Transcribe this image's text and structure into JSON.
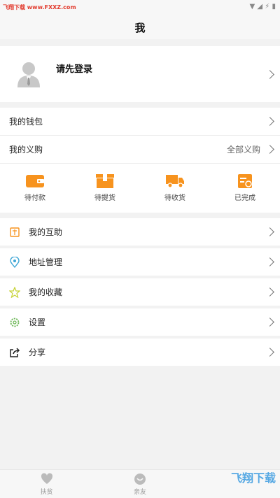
{
  "statusbar": {
    "watermark": "飞翔下载 www.FXXZ.com"
  },
  "header": {
    "title": "我"
  },
  "profile": {
    "login_prompt": "请先登录"
  },
  "wallet": {
    "label": "我的钱包"
  },
  "purchases": {
    "label": "我的义购",
    "all_label": "全部义购"
  },
  "orders": [
    {
      "label": "待付款",
      "icon": "wallet-icon"
    },
    {
      "label": "待提货",
      "icon": "package-icon"
    },
    {
      "label": "待收货",
      "icon": "truck-icon"
    },
    {
      "label": "已完成",
      "icon": "completed-icon"
    }
  ],
  "menu": [
    {
      "label": "我的互助",
      "icon": "mutual-aid-icon"
    },
    {
      "label": "地址管理",
      "icon": "location-pin-icon"
    },
    {
      "label": "我的收藏",
      "icon": "star-icon"
    },
    {
      "label": "设置",
      "icon": "gear-icon"
    },
    {
      "label": "分享",
      "icon": "share-icon"
    }
  ],
  "tabbar": [
    {
      "label": "扶贫",
      "icon": "heart-icon"
    },
    {
      "label": "亲友",
      "icon": "friends-icon"
    }
  ],
  "watermark2": "飞翔下载",
  "colors": {
    "accent": "#f7931e",
    "background": "#f2f2f2"
  }
}
